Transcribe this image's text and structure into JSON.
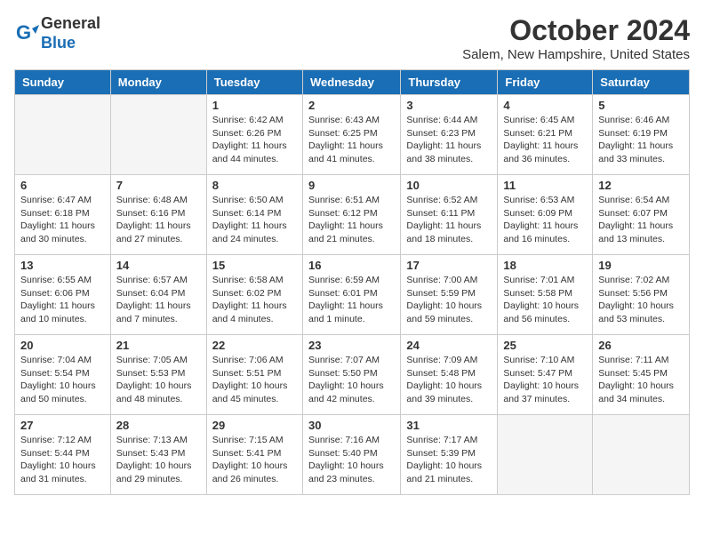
{
  "header": {
    "logo_line1": "General",
    "logo_line2": "Blue",
    "month": "October 2024",
    "location": "Salem, New Hampshire, United States"
  },
  "weekdays": [
    "Sunday",
    "Monday",
    "Tuesday",
    "Wednesday",
    "Thursday",
    "Friday",
    "Saturday"
  ],
  "weeks": [
    [
      {
        "day": "",
        "empty": true
      },
      {
        "day": "",
        "empty": true
      },
      {
        "day": "1",
        "sunrise": "6:42 AM",
        "sunset": "6:26 PM",
        "daylight": "11 hours and 44 minutes."
      },
      {
        "day": "2",
        "sunrise": "6:43 AM",
        "sunset": "6:25 PM",
        "daylight": "11 hours and 41 minutes."
      },
      {
        "day": "3",
        "sunrise": "6:44 AM",
        "sunset": "6:23 PM",
        "daylight": "11 hours and 38 minutes."
      },
      {
        "day": "4",
        "sunrise": "6:45 AM",
        "sunset": "6:21 PM",
        "daylight": "11 hours and 36 minutes."
      },
      {
        "day": "5",
        "sunrise": "6:46 AM",
        "sunset": "6:19 PM",
        "daylight": "11 hours and 33 minutes."
      }
    ],
    [
      {
        "day": "6",
        "sunrise": "6:47 AM",
        "sunset": "6:18 PM",
        "daylight": "11 hours and 30 minutes."
      },
      {
        "day": "7",
        "sunrise": "6:48 AM",
        "sunset": "6:16 PM",
        "daylight": "11 hours and 27 minutes."
      },
      {
        "day": "8",
        "sunrise": "6:50 AM",
        "sunset": "6:14 PM",
        "daylight": "11 hours and 24 minutes."
      },
      {
        "day": "9",
        "sunrise": "6:51 AM",
        "sunset": "6:12 PM",
        "daylight": "11 hours and 21 minutes."
      },
      {
        "day": "10",
        "sunrise": "6:52 AM",
        "sunset": "6:11 PM",
        "daylight": "11 hours and 18 minutes."
      },
      {
        "day": "11",
        "sunrise": "6:53 AM",
        "sunset": "6:09 PM",
        "daylight": "11 hours and 16 minutes."
      },
      {
        "day": "12",
        "sunrise": "6:54 AM",
        "sunset": "6:07 PM",
        "daylight": "11 hours and 13 minutes."
      }
    ],
    [
      {
        "day": "13",
        "sunrise": "6:55 AM",
        "sunset": "6:06 PM",
        "daylight": "11 hours and 10 minutes."
      },
      {
        "day": "14",
        "sunrise": "6:57 AM",
        "sunset": "6:04 PM",
        "daylight": "11 hours and 7 minutes."
      },
      {
        "day": "15",
        "sunrise": "6:58 AM",
        "sunset": "6:02 PM",
        "daylight": "11 hours and 4 minutes."
      },
      {
        "day": "16",
        "sunrise": "6:59 AM",
        "sunset": "6:01 PM",
        "daylight": "11 hours and 1 minute."
      },
      {
        "day": "17",
        "sunrise": "7:00 AM",
        "sunset": "5:59 PM",
        "daylight": "10 hours and 59 minutes."
      },
      {
        "day": "18",
        "sunrise": "7:01 AM",
        "sunset": "5:58 PM",
        "daylight": "10 hours and 56 minutes."
      },
      {
        "day": "19",
        "sunrise": "7:02 AM",
        "sunset": "5:56 PM",
        "daylight": "10 hours and 53 minutes."
      }
    ],
    [
      {
        "day": "20",
        "sunrise": "7:04 AM",
        "sunset": "5:54 PM",
        "daylight": "10 hours and 50 minutes."
      },
      {
        "day": "21",
        "sunrise": "7:05 AM",
        "sunset": "5:53 PM",
        "daylight": "10 hours and 48 minutes."
      },
      {
        "day": "22",
        "sunrise": "7:06 AM",
        "sunset": "5:51 PM",
        "daylight": "10 hours and 45 minutes."
      },
      {
        "day": "23",
        "sunrise": "7:07 AM",
        "sunset": "5:50 PM",
        "daylight": "10 hours and 42 minutes."
      },
      {
        "day": "24",
        "sunrise": "7:09 AM",
        "sunset": "5:48 PM",
        "daylight": "10 hours and 39 minutes."
      },
      {
        "day": "25",
        "sunrise": "7:10 AM",
        "sunset": "5:47 PM",
        "daylight": "10 hours and 37 minutes."
      },
      {
        "day": "26",
        "sunrise": "7:11 AM",
        "sunset": "5:45 PM",
        "daylight": "10 hours and 34 minutes."
      }
    ],
    [
      {
        "day": "27",
        "sunrise": "7:12 AM",
        "sunset": "5:44 PM",
        "daylight": "10 hours and 31 minutes."
      },
      {
        "day": "28",
        "sunrise": "7:13 AM",
        "sunset": "5:43 PM",
        "daylight": "10 hours and 29 minutes."
      },
      {
        "day": "29",
        "sunrise": "7:15 AM",
        "sunset": "5:41 PM",
        "daylight": "10 hours and 26 minutes."
      },
      {
        "day": "30",
        "sunrise": "7:16 AM",
        "sunset": "5:40 PM",
        "daylight": "10 hours and 23 minutes."
      },
      {
        "day": "31",
        "sunrise": "7:17 AM",
        "sunset": "5:39 PM",
        "daylight": "10 hours and 21 minutes."
      },
      {
        "day": "",
        "empty": true
      },
      {
        "day": "",
        "empty": true
      }
    ]
  ]
}
